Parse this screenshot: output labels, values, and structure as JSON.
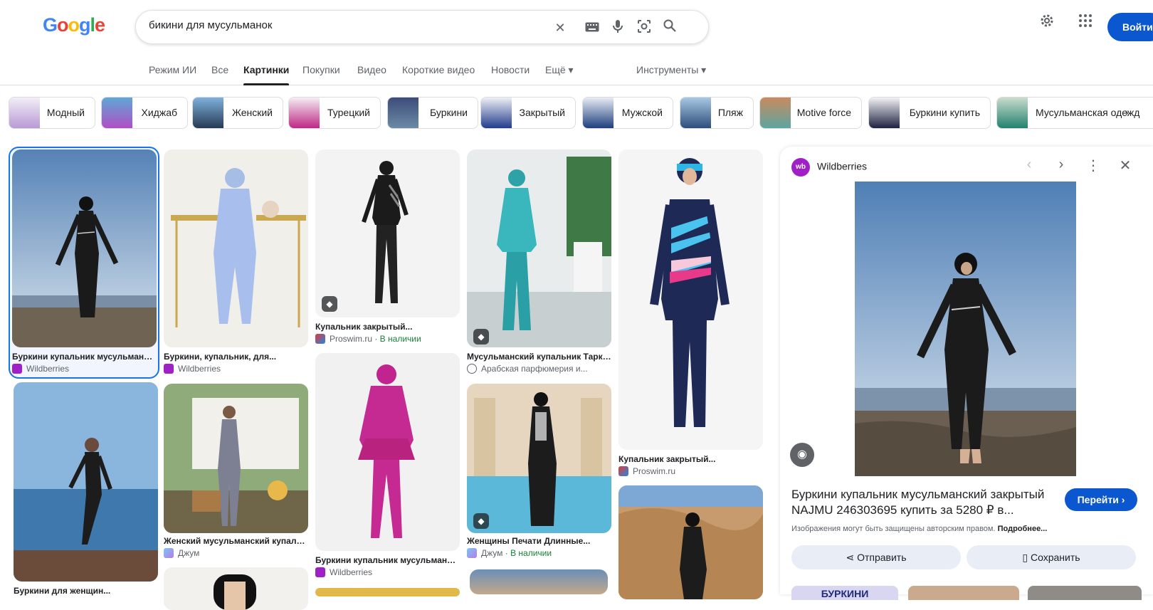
{
  "logo": [
    "G",
    "o",
    "o",
    "g",
    "l",
    "e"
  ],
  "search": {
    "query": "бикини для мусульманок"
  },
  "header": {
    "signin_label": "Войти"
  },
  "tabs": [
    "Режим ИИ",
    "Все",
    "Картинки",
    "Покупки",
    "Видео",
    "Короткие видео",
    "Новости",
    "Ещё ▾",
    "Инструменты ▾"
  ],
  "chips": [
    "Модный",
    "Хиджаб",
    "Женский",
    "Турецкий",
    "Буркини",
    "Закрытый",
    "Мужской",
    "Пляж",
    "Motive force",
    "Буркини купить",
    "Мусульманская одежд"
  ],
  "results": [
    {
      "title": "Буркини купальник мусульманский...",
      "source": "Wildberries"
    },
    {
      "title": "Буркини, купальник, для...",
      "source": "Wildberries"
    },
    {
      "title": "Купальник закрытый...",
      "source": "Proswim.ru",
      "stock": " · В наличии"
    },
    {
      "title": "Мусульманский купальник Таркваз",
      "source": "Арабская парфюмерия и..."
    },
    {
      "title": "Купальник закрытый...",
      "source": "Proswim.ru"
    },
    {
      "title": "Женский мусульманский купальник...",
      "source": "Джум"
    },
    {
      "title": "Буркини купальник мусульманский...",
      "source": "Wildberries"
    },
    {
      "title": "Женщины Печати Длинные...",
      "source": "Джум",
      "stock": " · В наличии"
    },
    {
      "title": "Буркини для женщин...",
      "source": ""
    }
  ],
  "panel": {
    "source": "Wildberries",
    "fav_text": "wb",
    "title": "Буркини купальник мусульманский закрытый NAJMU 246303695 купить за 5280 ₽ в...",
    "goto_label": "Перейти ›",
    "copyright": "Изображения могут быть защищены авторским правом.",
    "more_label": "Подробнее...",
    "share_label": "Отправить",
    "save_label": "Сохранить",
    "related_text": "БУРКИНИ"
  },
  "colors": {
    "accent": "#0b57d0",
    "selected": "#1a73e8",
    "stock": "#188038"
  }
}
